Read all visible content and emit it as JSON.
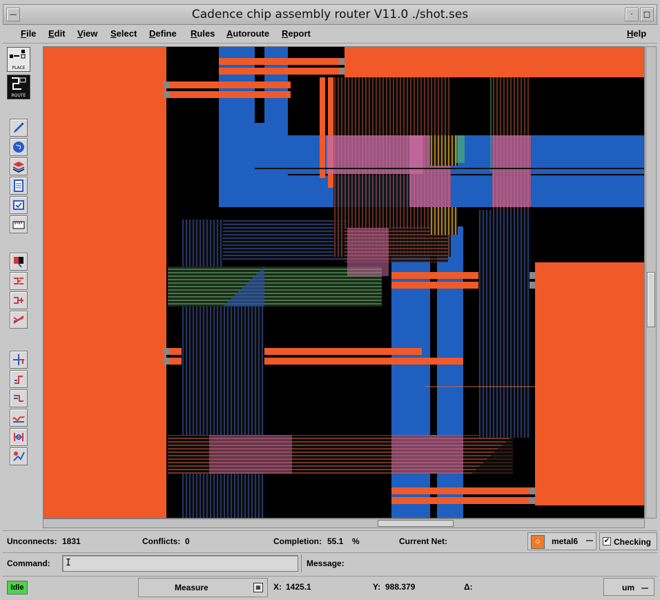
{
  "window": {
    "title": "Cadence chip assembly router V11.0 ./shot.ses"
  },
  "menu": {
    "items": [
      "File",
      "Edit",
      "View",
      "Select",
      "Define",
      "Rules",
      "Autoroute",
      "Report"
    ],
    "help": "Help"
  },
  "toolbar": {
    "place_label": "PLACE",
    "route_label": "ROUTE",
    "tools": [
      "pencil-icon",
      "globe-icon",
      "layers-icon",
      "document-icon",
      "checklist-icon",
      "ruler-icon",
      "color-select-icon",
      "fanout-icon",
      "split-icon",
      "crossing-icon",
      "move-icon",
      "corner-route-icon",
      "step-route-icon",
      "wave-route-icon",
      "cut-route-icon",
      "auto-route-icon"
    ]
  },
  "status": {
    "unconnects_label": "Unconnects:",
    "unconnects_value": "1831",
    "conflicts_label": "Conflicts:",
    "conflicts_value": "0",
    "completion_label": "Completion:",
    "completion_value": "55.1",
    "completion_unit": "%",
    "current_net_label": "Current Net:",
    "current_net_value": "",
    "layer": "metal6",
    "checking_label": "Checking",
    "checking_on": true
  },
  "command": {
    "label": "Command:",
    "value": "",
    "message_label": "Message:",
    "message_value": ""
  },
  "bottom": {
    "state": "Idle",
    "mode": "Measure",
    "x_label": "X:",
    "x_value": "1425.1",
    "y_label": "Y:",
    "y_value": "988.379",
    "delta_label": "Δ:",
    "units": "um"
  },
  "colors": {
    "metal_orange": "#f05a28",
    "metal_blue": "#1f5fbf",
    "trace_green": "#58b868",
    "trace_pink": "#d870a0",
    "background": "#000000",
    "idle_green": "#4cd44c"
  }
}
